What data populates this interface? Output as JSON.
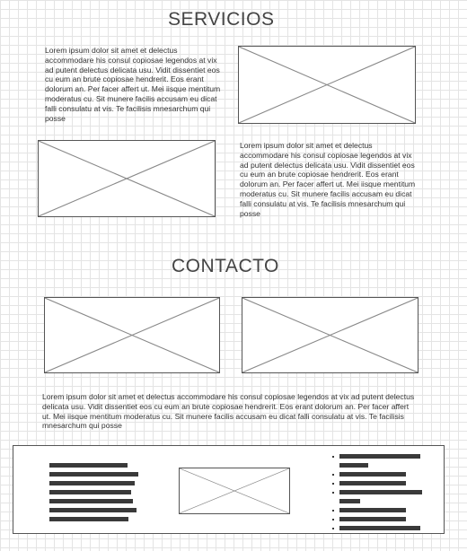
{
  "sections": {
    "servicios": {
      "title": "SERVICIOS"
    },
    "contacto": {
      "title": "CONTACTO"
    }
  },
  "lorem": {
    "service_1": "Lorem ipsum dolor sit amet et delectus accommodare his consul copiosae legendos at vix ad putent delectus delicata usu. Vidit dissentiet eos cu eum an brute copiosae hendrerit. Eos erant dolorum an. Per facer affert ut. Mei iisque mentitum moderatus cu. Sit munere facilis accusam eu dicat falli consulatu at vis. Te facilisis mnesarchum qui posse",
    "service_2": "Lorem ipsum dolor sit amet et delectus accommodare his consul copiosae legendos at vix ad putent delectus delicata usu. Vidit dissentiet eos cu eum an brute copiosae hendrerit. Eos erant dolorum an. Per facer affert ut. Mei iisque mentitum moderatus cu. Sit munere facilis accusam eu dicat falli consulatu at vis. Te facilisis mnesarchum qui posse",
    "contact": "Lorem ipsum dolor sit amet et delectus accommodare his consul copiosae legendos at vix ad putent delectus delicata usu. Vidit dissentiet eos cu eum an brute copiosae hendrerit. Eos erant dolorum an. Per facer affert ut. Mei iisque mentitum moderatus cu. Sit munere facilis accusam eu dicat falli consulatu at vis. Te facilisis mnesarchum qui posse"
  },
  "colors": {
    "grid": "#e4e4e4",
    "border": "#555555",
    "bar": "#3a3a3a",
    "text": "#333333"
  }
}
